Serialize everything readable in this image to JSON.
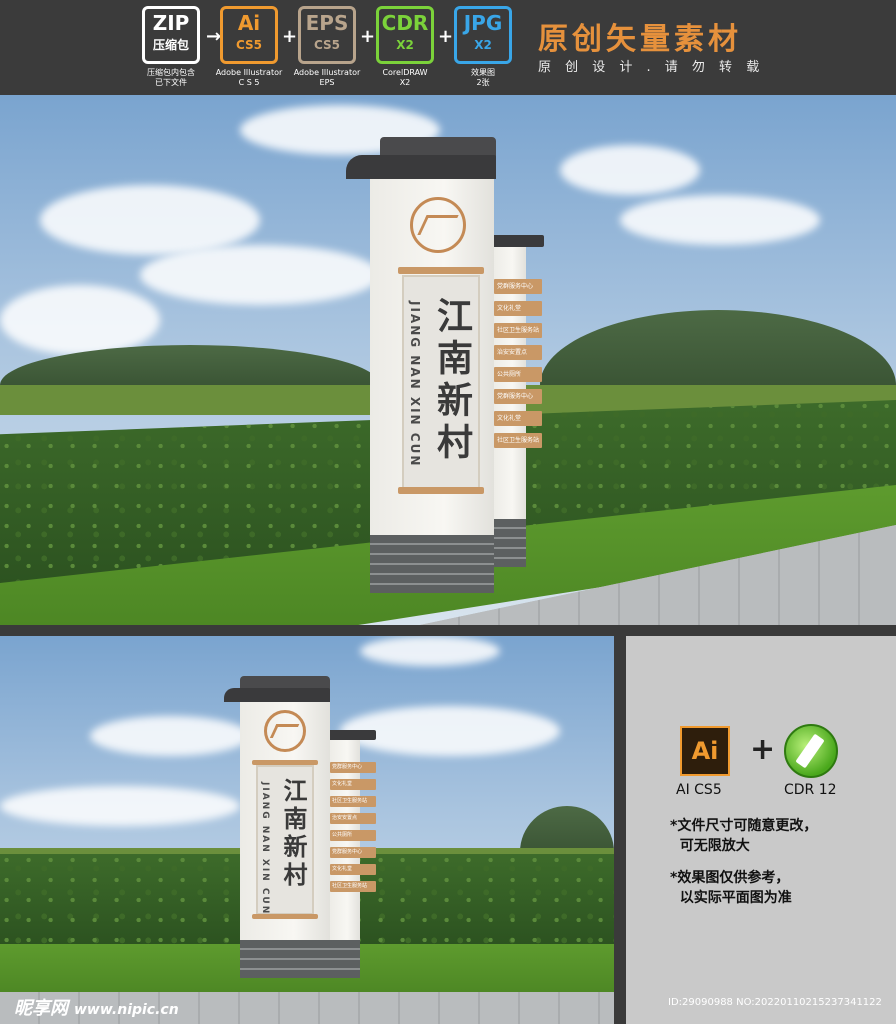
{
  "header": {
    "formats": [
      {
        "name": "ZIP",
        "sub": "压缩包",
        "color": "#ffffff",
        "caption": [
          "压缩包内包含",
          "已下文件"
        ]
      },
      {
        "name": "Ai",
        "sub": "CS5",
        "color": "#f09a2f",
        "caption": [
          "Adobe Illustrator",
          "C S 5"
        ]
      },
      {
        "name": "EPS",
        "sub": "CS5",
        "color": "#b8a48c",
        "caption": [
          "Adobe Illustrator",
          "EPS"
        ]
      },
      {
        "name": "CDR",
        "sub": "X2",
        "color": "#7bd23a",
        "caption": [
          "CorelDRAW",
          "X2"
        ]
      },
      {
        "name": "JPG",
        "sub": "X2",
        "color": "#39a6e8",
        "caption": [
          "效果图",
          "2张"
        ]
      }
    ],
    "arrow": "→",
    "plus": "+",
    "slogan": "原创矢量素材",
    "sub_slogan": "原 创 设 计 . 请 勿 转 载"
  },
  "sign": {
    "title": "江南新村",
    "pinyin": "JIANG NAN XIN CUN",
    "direction_plates": [
      "党群服务中心",
      "文化礼堂",
      "社区卫生服务站",
      "治安安置点",
      "公共厕所",
      "党群服务中心",
      "文化礼堂",
      "社区卫生服务站"
    ]
  },
  "info": {
    "ai_icon": "Ai",
    "plus": "+",
    "ai_label": "AI CS5",
    "cdr_label": "CDR 12",
    "notes": [
      [
        "*文件尺寸可随意更改，",
        "  可无限放大"
      ],
      [
        "*效果图仅供参考，",
        "  以实际平面图为准"
      ]
    ]
  },
  "watermark": {
    "brand": "昵享网",
    "url": "www.nipic.cn",
    "id_text": "ID:29090988 NO:20220110215237341122"
  }
}
